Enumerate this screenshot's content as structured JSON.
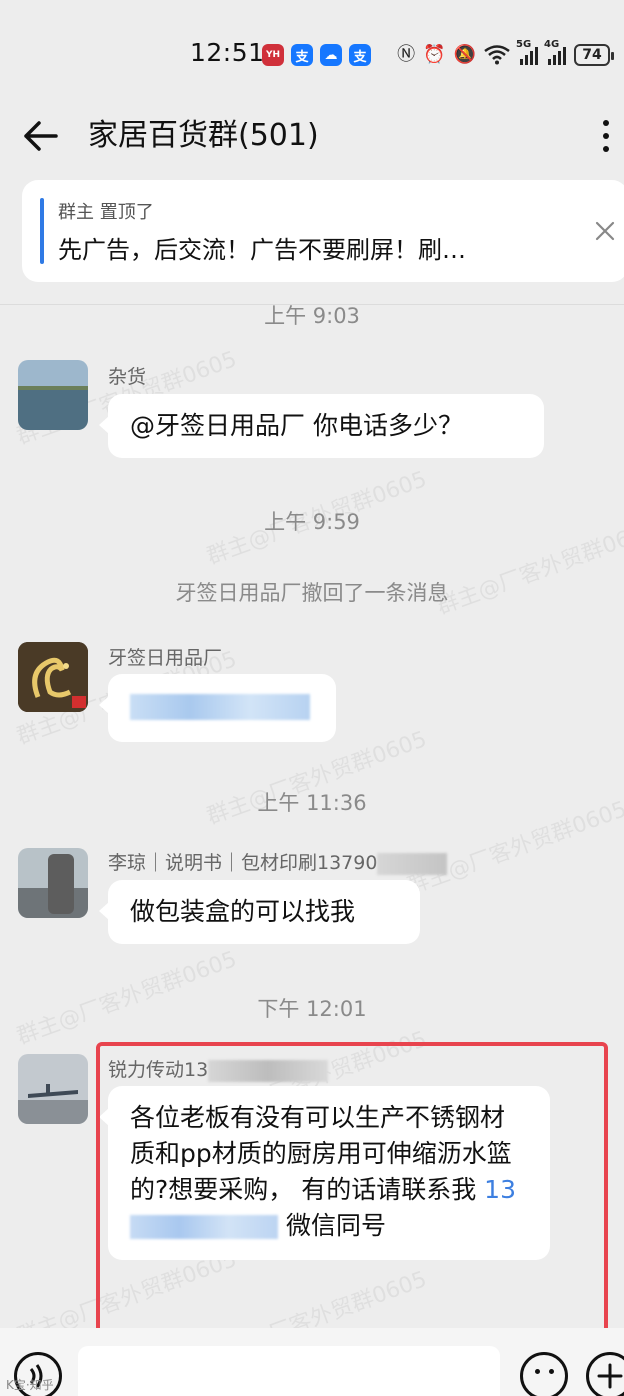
{
  "status_bar": {
    "time": "12:51",
    "apps": [
      {
        "icon": "yh-app-icon",
        "text": "YH",
        "color": "#d0303a"
      },
      {
        "icon": "alipay-icon",
        "text": "支",
        "color": "#1677ff"
      },
      {
        "icon": "cloud-app-icon",
        "text": "☁",
        "color": "#1677ff"
      },
      {
        "icon": "alipay-icon",
        "text": "支",
        "color": "#1677ff"
      }
    ],
    "signal_5g": "5G",
    "signal_4g": "4G",
    "battery": "74"
  },
  "header": {
    "title": "家居百货群(501)"
  },
  "pinned": {
    "meta": "群主 置顶了",
    "text": "先广告，后交流！广告不要刷屏！刷…"
  },
  "messages": {
    "time_1": "上午 9:03",
    "msg_1": {
      "sender": "杂货",
      "text": "@牙签日用品厂 你电话多少？"
    },
    "time_2": "上午 9:59",
    "system_1": "牙签日用品厂撤回了一条消息",
    "msg_2": {
      "sender": "牙签日用品厂"
    },
    "time_3": "上午 11:36",
    "msg_3": {
      "sender": "李琼｜说明书｜包材印刷13790",
      "text": "做包装盒的可以找我"
    },
    "time_4": "下午 12:01",
    "msg_4": {
      "sender": "锐力传动13",
      "text_main": "各位老板有没有可以生产不锈钢材质和pp材质的厨房用可伸缩沥水篮的?想要采购， 有的话请联系我 ",
      "phone": "13",
      "text_tail": " 微信同号"
    }
  },
  "watermark": "群主@厂客外贸群0605",
  "bottom_label": "K宝·知乎"
}
